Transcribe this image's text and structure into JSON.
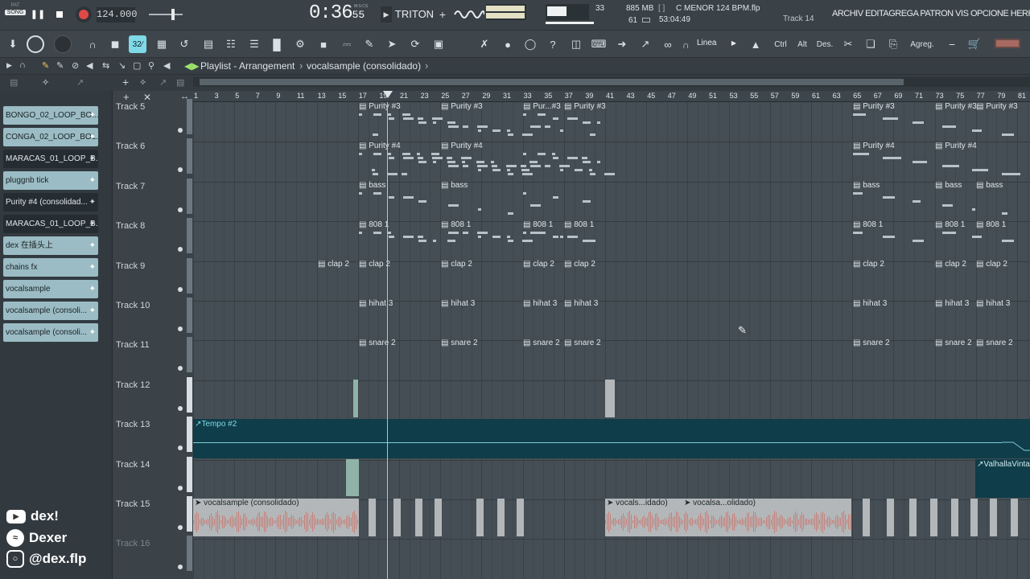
{
  "transport": {
    "mode_top": "PAT",
    "mode_bottom": "SONG",
    "tempo": "124.000",
    "time_main": "0:36",
    "time_sub": "55",
    "time_unit": "M:S:CS",
    "plugin_name": "TRITON",
    "plus": "+",
    "cpu_value": "33",
    "memory": "885 MB",
    "polyphony": "61",
    "project_file": "C MENOR 124 BPM.flp",
    "project_time": "53:04:49",
    "hint_track": "Track 14",
    "bracket": "[ ]"
  },
  "menu": {
    "archivo": "ARCHIV",
    "editar": "EDITA",
    "agregar": "GREGA",
    "patron": "PATRON",
    "vista": "VIS",
    "opciones": "OPCIONE",
    "herramientas": "HERRAMIEN"
  },
  "toolbar": {
    "snap_label": "Linea",
    "ctrl_label": "Ctrl",
    "alt_label": "Alt",
    "des_label": "Des.",
    "agreg_label": "Agreg.",
    "tool_32_label": "32∕"
  },
  "playlist": {
    "title": "Playlist - Arrangement",
    "separator": "›",
    "current_pattern": "vocalsample (consolidado)",
    "arrow": "›"
  },
  "ruler": {
    "ticks": [
      "1",
      "3",
      "5",
      "7",
      "9",
      "11",
      "13",
      "15",
      "17",
      "19",
      "21",
      "23",
      "25",
      "27",
      "29",
      "31",
      "33",
      "35",
      "37",
      "39",
      "41",
      "43",
      "45",
      "47",
      "49",
      "51",
      "53",
      "55",
      "57",
      "59",
      "61",
      "63",
      "65",
      "67",
      "69",
      "71",
      "73",
      "75",
      "77",
      "79",
      "81"
    ]
  },
  "browser": {
    "channels": [
      {
        "label": "BONGO_02_LOOP_BO...",
        "style": "light"
      },
      {
        "label": "CONGA_02_LOOP_BOL...",
        "style": "light"
      },
      {
        "label": "MARACAS_01_LOOP_B...",
        "style": "dark"
      },
      {
        "label": "pluggnb tick",
        "style": "light"
      },
      {
        "label": "Purity #4 (consolidad...",
        "style": "dark"
      },
      {
        "label": "MARACAS_01_LOOP_B...",
        "style": "dark"
      },
      {
        "label": "dex 在插头上",
        "style": "light"
      },
      {
        "label": "chains fx",
        "style": "light"
      },
      {
        "label": "vocalsample",
        "style": "light"
      },
      {
        "label": "vocalsample (consoli...",
        "style": "light"
      },
      {
        "label": "vocalsample (consoli...",
        "style": "light"
      }
    ]
  },
  "tracks": [
    "Track 5",
    "Track 6",
    "Track 7",
    "Track 8",
    "Track 9",
    "Track 10",
    "Track 11",
    "Track 12",
    "Track 13",
    "Track 14",
    "Track 15",
    "Track 16"
  ],
  "clips": {
    "purity3_a": "Purity #3",
    "purity3_b": "Purity #3",
    "purity3_c": "Pur...#3",
    "purity3_d": "Purity #3",
    "purity3_e": "Purity #3",
    "purity3_f": "Purity #3",
    "purity3_g": "Purity #3",
    "purity4_a": "Purity #4",
    "purity4_b": "Purity #4",
    "purity4_c": "Purity #4",
    "purity4_d": "Purity #4",
    "bass_a": "bass",
    "bass_b": "bass",
    "bass_c": "bass",
    "bass_d": "bass",
    "bass_e": "bass",
    "b808_a": "808 1",
    "b808_b": "808 1",
    "b808_c": "808 1",
    "b808_d": "808 1",
    "b808_e": "808 1",
    "b808_f": "808 1",
    "b808_g": "808 1",
    "clap_0": "clap 2",
    "clap_a": "clap 2",
    "clap_b": "clap 2",
    "clap_c": "clap 2",
    "clap_d": "clap 2",
    "clap_e": "clap 2",
    "clap_f": "clap 2",
    "clap_g": "clap 2",
    "hihat_a": "hihat 3",
    "hihat_b": "hihat 3",
    "hihat_c": "hihat 3",
    "hihat_d": "hihat 3",
    "hihat_e": "hihat 3",
    "hihat_f": "hihat 3",
    "hihat_g": "hihat 3",
    "snare_a": "snare 2",
    "snare_b": "snare 2",
    "snare_c": "snare 2",
    "snare_d": "snare 2",
    "snare_e": "snare 2",
    "snare_f": "snare 2",
    "snare_g": "snare 2",
    "tempo": "Tempo #2",
    "valhalla": "ValhallaVintag",
    "vocal_a": "vocalsample (consolidado)",
    "vocal_b": "vocals...idado)",
    "vocal_c": "vocalsa...olidado)"
  },
  "social": {
    "youtube": "dex!",
    "spotify": "Dexer",
    "instagram": "@dex.flp"
  },
  "colors": {
    "tempo_track": "#0f3d49",
    "audio_clip": "#b3b7b9",
    "channel_light": "#a9c8cf",
    "channel_dark": "#2b3237",
    "playhead": "#a9c6cf",
    "selected_tool": "#7fd9e6"
  }
}
